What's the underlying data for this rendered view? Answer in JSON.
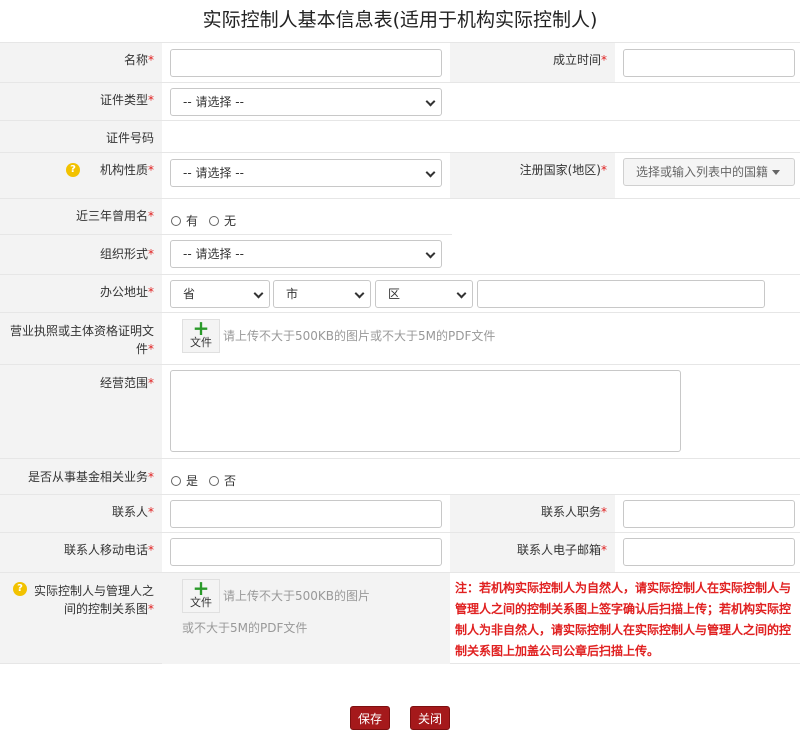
{
  "title": "实际控制人基本信息表(适用于机构实际控制人)",
  "fields": {
    "name": "名称",
    "established": "成立时间",
    "id_type": "证件类型",
    "id_number": "证件号码",
    "org_nature": "机构性质",
    "reg_country": "注册国家(地区)",
    "former_name": "近三年曾用名",
    "org_form": "组织形式",
    "office_addr": "办公地址",
    "license_line1": "营业执照或主体资格证明文",
    "license_line2": "件",
    "biz_scope": "经营范围",
    "fund_biz": "是否从事基金相关业务",
    "contact": "联系人",
    "contact_title": "联系人职务",
    "contact_phone": "联系人移动电话",
    "contact_email": "联系人电子邮箱",
    "relation_line1": "实际控制人与管理人之",
    "relation_line2": "间的控制关系图"
  },
  "required_mark": "*",
  "help_mark": "?",
  "select_placeholder": "-- 请选择 --",
  "country_placeholder": "选择或输入列表中的国籍",
  "address": {
    "province": "省",
    "city": "市",
    "district": "区"
  },
  "radios": {
    "has": "有",
    "none": "无",
    "yes": "是",
    "no": "否"
  },
  "upload": {
    "plus": "+",
    "file_label": "文件",
    "hint_license": "请上传不大于500KB的图片或不大于5M的PDF文件",
    "hint_relation_1": "请上传不大于500KB的图片",
    "hint_relation_2": "或不大于5M的PDF文件"
  },
  "note": "注：若机构实际控制人为自然人，请实际控制人在实际控制人与管理人之间的控制关系图上签字确认后扫描上传；若机构实际控制人为非自然人，请实际控制人在实际控制人与管理人之间的控制关系图上加盖公司公章后扫描上传。",
  "buttons": {
    "save": "保存",
    "close": "关闭"
  },
  "colors": {
    "required": "#e02020",
    "button": "#a5191b",
    "label_bg": "#f3f3f3",
    "help": "#f2c200",
    "plus": "#2a9a2a"
  }
}
